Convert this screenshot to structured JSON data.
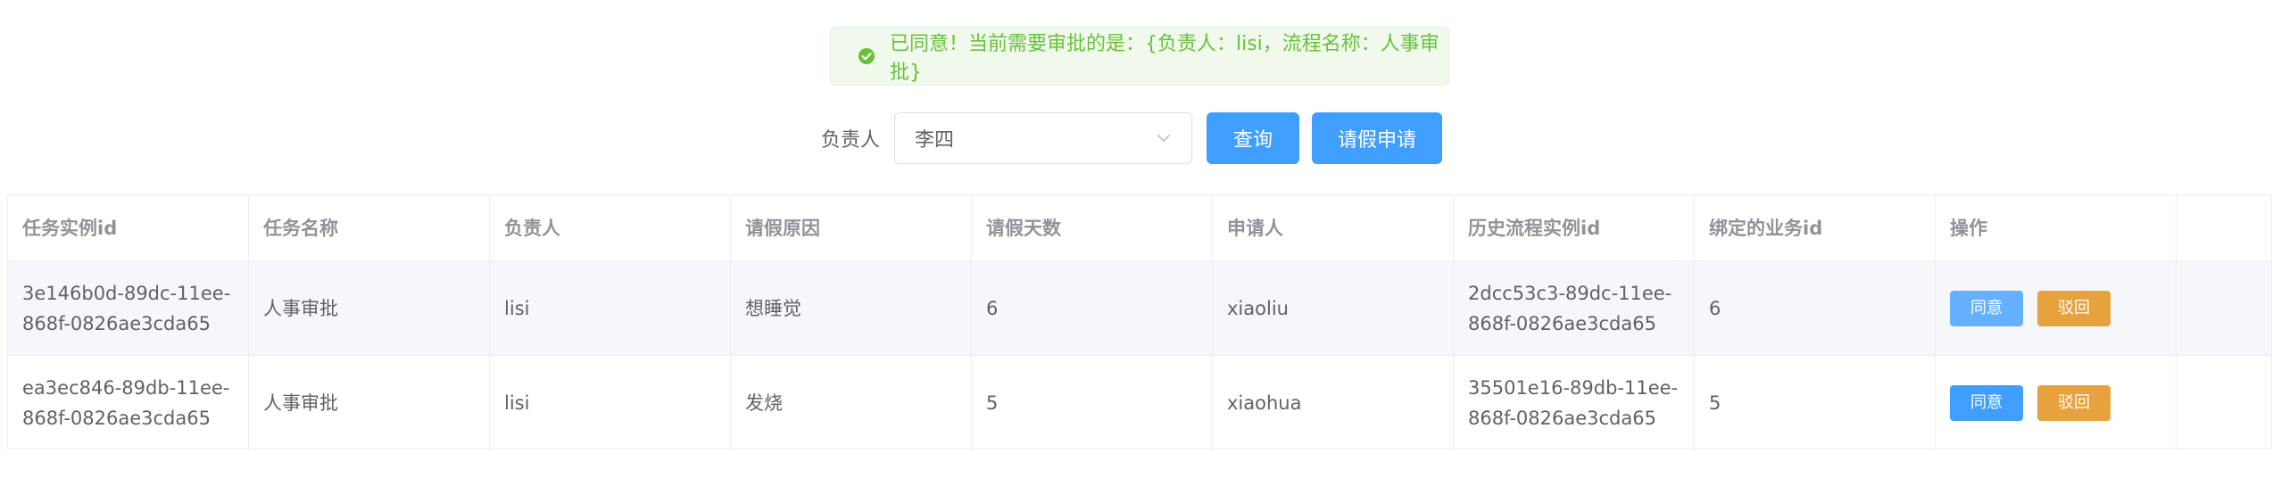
{
  "alert": {
    "message": "已同意！当前需要审批的是：{负责人：lisi，流程名称：人事审批}",
    "color": "#67c23a"
  },
  "search": {
    "label": "负责人",
    "selected": "李四",
    "query_button": "查询",
    "leave_button": "请假申请"
  },
  "table": {
    "headers": [
      "任务实例id",
      "任务名称",
      "负责人",
      "请假原因",
      "请假天数",
      "申请人",
      "历史流程实例id",
      "绑定的业务id",
      "操作"
    ],
    "rows": [
      {
        "task_id": "3e146b0d-89dc-11ee-868f-0826ae3cda65",
        "task_name": "人事审批",
        "assignee": "lisi",
        "reason": "想睡觉",
        "days": "6",
        "applicant": "xiaoliu",
        "history_id": "2dcc53c3-89dc-11ee-868f-0826ae3cda65",
        "business_id": "6",
        "agree": "同意",
        "reject": "驳回"
      },
      {
        "task_id": "ea3ec846-89db-11ee-868f-0826ae3cda65",
        "task_name": "人事审批",
        "assignee": "lisi",
        "reason": "发烧",
        "days": "5",
        "applicant": "xiaohua",
        "history_id": "35501e16-89db-11ee-868f-0826ae3cda65",
        "business_id": "5",
        "agree": "同意",
        "reject": "驳回"
      }
    ]
  },
  "colors": {
    "primary": "#409eff",
    "warning": "#e6a23c",
    "success": "#67c23a"
  }
}
